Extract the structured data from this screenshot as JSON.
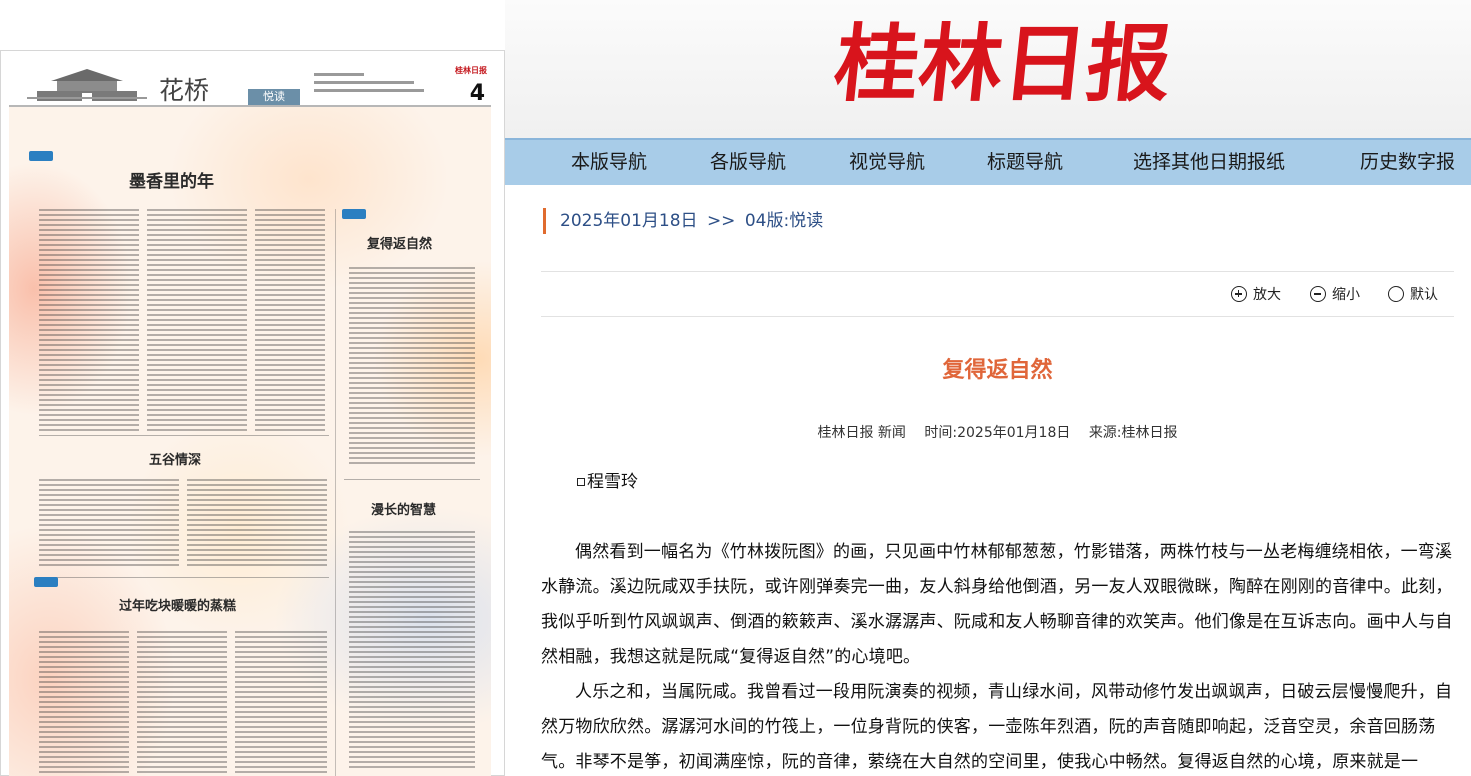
{
  "thumbnail": {
    "section_name": "花桥",
    "section_tag": "悦读",
    "page_number": "4",
    "paper_logo": "桂林日报",
    "headlines": [
      "墨香里的年",
      "复得返自然",
      "五谷情深",
      "漫长的智慧",
      "过年吃块暖暖的蒸糕"
    ]
  },
  "masthead": {
    "logo": "桂林日报"
  },
  "nav": {
    "items": [
      "本版导航",
      "各版导航",
      "视觉导航",
      "标题导航",
      "选择其他日期报纸",
      "历史数字报"
    ]
  },
  "breadcrumb": {
    "date": "2025年01月18日",
    "separator": ">>",
    "section": "04版:悦读"
  },
  "toolbar": {
    "zoom_in": "放大",
    "zoom_out": "缩小",
    "default": "默认"
  },
  "article": {
    "title": "复得返自然",
    "meta": {
      "source": "桂林日报 新闻",
      "time": "时间:2025年01月18日",
      "origin": "来源:桂林日报"
    },
    "author": "程雪玲",
    "paragraphs": [
      "偶然看到一幅名为《竹林拨阮图》的画，只见画中竹林郁郁葱葱，竹影错落，两株竹枝与一丛老梅缠绕相依，一弯溪水静流。溪边阮咸双手扶阮，或许刚弹奏完一曲，友人斜身给他倒酒，另一友人双眼微眯，陶醉在刚刚的音律中。此刻，我似乎听到竹风飒飒声、倒酒的簌簌声、溪水潺潺声、阮咸和友人畅聊音律的欢笑声。他们像是在互诉志向。画中人与自然相融，我想这就是阮咸“复得返自然”的心境吧。",
      "人乐之和，当属阮咸。我曾看过一段用阮演奏的视频，青山绿水间，风带动修竹发出飒飒声，日破云层慢慢爬升，自然万物欣欣然。潺潺河水间的竹筏上，一位身背阮的侠客，一壶陈年烈酒，阮的声音随即响起，泛音空灵，余音回肠荡气。非琴不是筝，初闻满座惊，阮的音律，萦绕在大自然的空间里，使我心中畅然。复得返自然的心境，原来就是一"
    ]
  }
}
